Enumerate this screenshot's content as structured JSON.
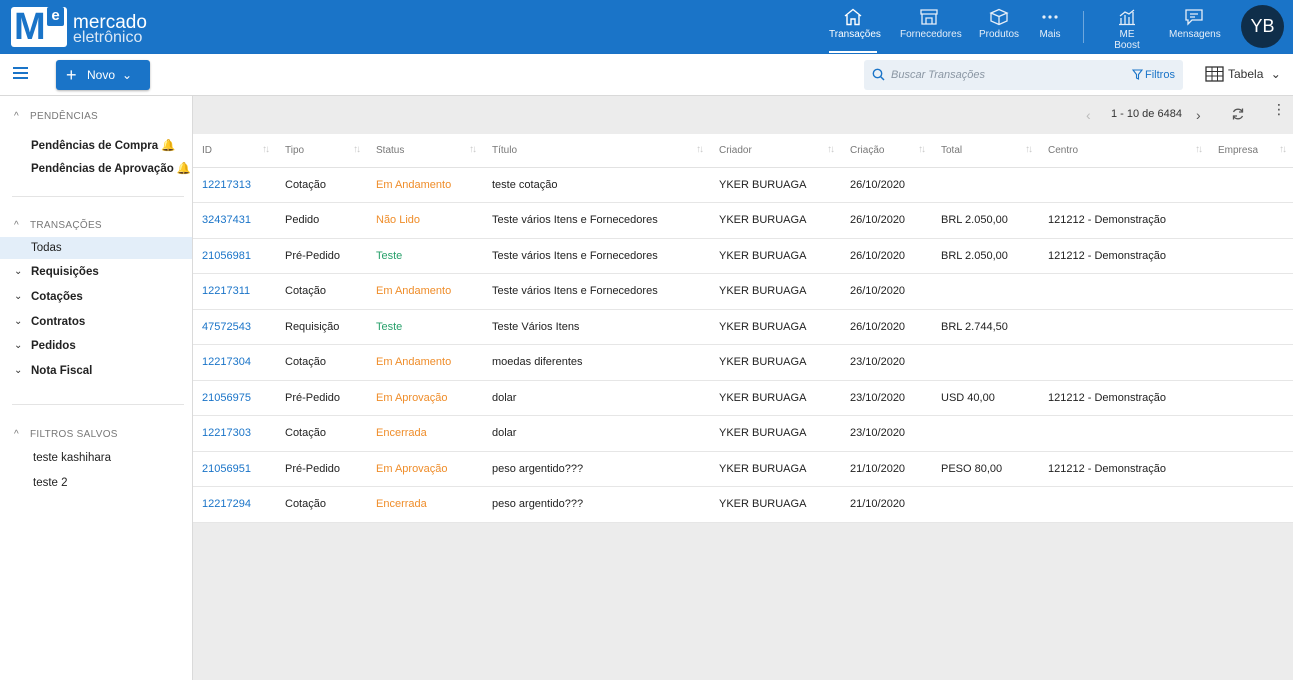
{
  "brand": {
    "line1": "mercado",
    "line2": "eletrônico",
    "logo_m": "M",
    "logo_e": "e"
  },
  "nav": [
    {
      "label": "Transações",
      "icon": "home-icon",
      "active": true
    },
    {
      "label": "Fornecedores",
      "icon": "store-icon"
    },
    {
      "label": "Produtos",
      "icon": "box-icon"
    },
    {
      "label": "Mais",
      "icon": "more-dots-icon"
    },
    {
      "label": "ME Boost",
      "icon": "chart-icon"
    },
    {
      "label": "Mensagens",
      "icon": "message-icon"
    }
  ],
  "user": {
    "initials": "YB"
  },
  "toolbar": {
    "new_label": "Novo",
    "new_plus": "+",
    "new_chevron": "⌄",
    "search_placeholder": "Buscar Transações",
    "filters_label": "Filtros",
    "view_label": "Tabela",
    "view_chevron": "⌄"
  },
  "sidebar": {
    "pendencias_title": "PENDÊNCIAS",
    "pendencias": [
      "Pendências de Compra",
      "Pendências de Aprovação"
    ],
    "transacoes_title": "TRANSAÇÕES",
    "active_item": "Todas",
    "groups": [
      "Requisições",
      "Cotações",
      "Contratos",
      "Pedidos",
      "Nota Fiscal"
    ],
    "filtros_title": "FILTROS SALVOS",
    "filtros": [
      "teste kashihara",
      "teste 2"
    ],
    "caret_up": "^",
    "caret_down": "⌄",
    "bell": "🔔"
  },
  "pager": {
    "range": "1 - 10 de 6484",
    "prev": "‹",
    "next": "›",
    "more": "⋮"
  },
  "colors": {
    "primary": "#1a74c8",
    "orange": "#ef8d2a",
    "green": "#28a06b",
    "bell": "#f39a1e"
  },
  "table": {
    "columns": [
      "ID",
      "Tipo",
      "Status",
      "Título",
      "Criador",
      "Criação",
      "Total",
      "Centro",
      "Empresa"
    ],
    "sort_glyph": "↑↓",
    "rows": [
      {
        "id": "12217313",
        "tipo": "Cotação",
        "status": "Em Andamento",
        "status_color": "orange",
        "titulo": "teste cotação",
        "criador": "YKER BURUAGA",
        "criacao": "26/10/2020",
        "total": "",
        "centro": "",
        "empresa": ""
      },
      {
        "id": "32437431",
        "tipo": "Pedido",
        "status": "Não Lido",
        "status_color": "orange",
        "titulo": "Teste vários Itens e Fornecedores",
        "criador": "YKER BURUAGA",
        "criacao": "26/10/2020",
        "total": "BRL 2.050,00",
        "centro": "121212 - Demonstração",
        "empresa": ""
      },
      {
        "id": "21056981",
        "tipo": "Pré-Pedido",
        "status": "Teste",
        "status_color": "green",
        "titulo": "Teste vários Itens e Fornecedores",
        "criador": "YKER BURUAGA",
        "criacao": "26/10/2020",
        "total": "BRL 2.050,00",
        "centro": "121212 - Demonstração",
        "empresa": ""
      },
      {
        "id": "12217311",
        "tipo": "Cotação",
        "status": "Em Andamento",
        "status_color": "orange",
        "titulo": "Teste vários Itens e Fornecedores",
        "criador": "YKER BURUAGA",
        "criacao": "26/10/2020",
        "total": "",
        "centro": "",
        "empresa": ""
      },
      {
        "id": "47572543",
        "tipo": "Requisição",
        "status": "Teste",
        "status_color": "green",
        "titulo": "Teste Vários Itens",
        "criador": "YKER BURUAGA",
        "criacao": "26/10/2020",
        "total": "BRL 2.744,50",
        "centro": "",
        "empresa": ""
      },
      {
        "id": "12217304",
        "tipo": "Cotação",
        "status": "Em Andamento",
        "status_color": "orange",
        "titulo": "moedas diferentes",
        "criador": "YKER BURUAGA",
        "criacao": "23/10/2020",
        "total": "",
        "centro": "",
        "empresa": ""
      },
      {
        "id": "21056975",
        "tipo": "Pré-Pedido",
        "status": "Em Aprovação",
        "status_color": "orange",
        "titulo": "dolar",
        "criador": "YKER BURUAGA",
        "criacao": "23/10/2020",
        "total": "USD 40,00",
        "centro": "121212 - Demonstração",
        "empresa": ""
      },
      {
        "id": "12217303",
        "tipo": "Cotação",
        "status": "Encerrada",
        "status_color": "orange",
        "titulo": "dolar",
        "criador": "YKER BURUAGA",
        "criacao": "23/10/2020",
        "total": "",
        "centro": "",
        "empresa": ""
      },
      {
        "id": "21056951",
        "tipo": "Pré-Pedido",
        "status": "Em Aprovação",
        "status_color": "orange",
        "titulo": "peso argentido???",
        "criador": "YKER BURUAGA",
        "criacao": "21/10/2020",
        "total": "PESO 80,00",
        "centro": "121212 - Demonstração",
        "empresa": ""
      },
      {
        "id": "12217294",
        "tipo": "Cotação",
        "status": "Encerrada",
        "status_color": "orange",
        "titulo": "peso argentido???",
        "criador": "YKER BURUAGA",
        "criacao": "21/10/2020",
        "total": "",
        "centro": "",
        "empresa": ""
      }
    ]
  }
}
